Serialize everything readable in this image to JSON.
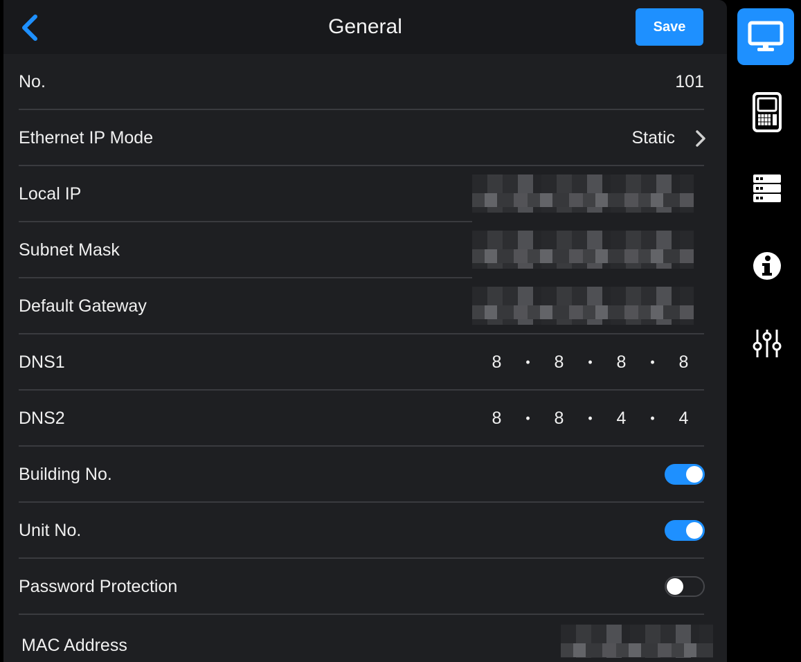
{
  "header": {
    "title": "General",
    "save_label": "Save"
  },
  "rows": [
    {
      "label": "No.",
      "value": "101"
    },
    {
      "label": "Ethernet IP Mode",
      "value": "Static"
    },
    {
      "label": "Local IP"
    },
    {
      "label": "Subnet Mask"
    },
    {
      "label": "Default Gateway"
    },
    {
      "label": "DNS1",
      "octets": [
        "8",
        "8",
        "8",
        "8"
      ]
    },
    {
      "label": "DNS2",
      "octets": [
        "8",
        "8",
        "4",
        "4"
      ]
    },
    {
      "label": "Building No.",
      "enabled": true
    },
    {
      "label": "Unit No.",
      "enabled": true
    },
    {
      "label": "Password Protection",
      "enabled": false
    },
    {
      "label": "MAC Address"
    }
  ],
  "separator": "•",
  "sidebar": {
    "items": [
      {
        "icon": "monitor-icon",
        "active": true
      },
      {
        "icon": "intercom-panel-icon",
        "active": false
      },
      {
        "icon": "server-icon",
        "active": false
      },
      {
        "icon": "info-icon",
        "active": false
      },
      {
        "icon": "sliders-icon",
        "active": false
      }
    ]
  },
  "colors": {
    "accent": "#1e90ff",
    "background": "#1e1f22",
    "header": "#18191c"
  }
}
